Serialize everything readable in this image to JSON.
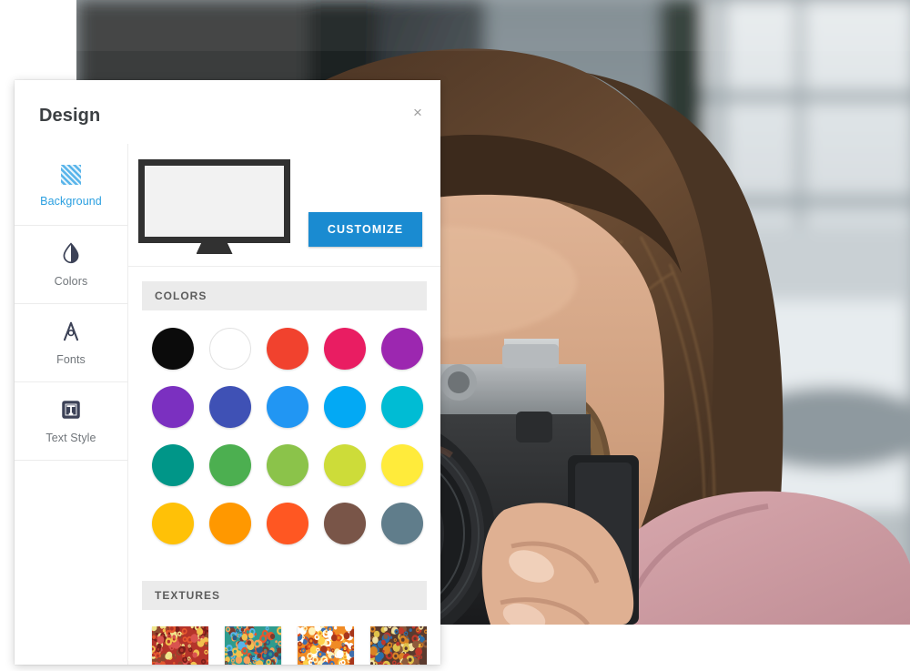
{
  "panel": {
    "title": "Design",
    "close_label": "×"
  },
  "sidebar": {
    "items": [
      {
        "label": "Background",
        "icon": "hatch-pattern-icon",
        "active": true
      },
      {
        "label": "Colors",
        "icon": "droplet-contrast-icon",
        "active": false
      },
      {
        "label": "Fonts",
        "icon": "letter-a-icon",
        "active": false
      },
      {
        "label": "Text Style",
        "icon": "text-style-t-icon",
        "active": false
      }
    ]
  },
  "preview": {
    "monitor_icon": "monitor-icon",
    "customize_label": "CUSTOMIZE",
    "accent_color": "#1a8bd1"
  },
  "colors_section": {
    "header": "COLORS",
    "rows": [
      [
        {
          "name": "black",
          "hex": "#0b0b0b"
        },
        {
          "name": "white",
          "hex": "#ffffff"
        },
        {
          "name": "red",
          "hex": "#f1422e"
        },
        {
          "name": "pink",
          "hex": "#e91d62"
        },
        {
          "name": "purple",
          "hex": "#9c27b0"
        }
      ],
      [
        {
          "name": "deep-purple",
          "hex": "#7b30c0"
        },
        {
          "name": "indigo",
          "hex": "#3f51b5"
        },
        {
          "name": "blue",
          "hex": "#2196f3"
        },
        {
          "name": "light-blue",
          "hex": "#03a9f4"
        },
        {
          "name": "cyan",
          "hex": "#00bcd4"
        }
      ],
      [
        {
          "name": "teal",
          "hex": "#009688"
        },
        {
          "name": "green",
          "hex": "#4caf50"
        },
        {
          "name": "light-green",
          "hex": "#8bc34a"
        },
        {
          "name": "lime",
          "hex": "#cddc39"
        },
        {
          "name": "yellow",
          "hex": "#ffeb3b"
        }
      ],
      [
        {
          "name": "amber",
          "hex": "#ffc107"
        },
        {
          "name": "orange",
          "hex": "#ff9800"
        },
        {
          "name": "deep-orange",
          "hex": "#ff5722"
        },
        {
          "name": "brown",
          "hex": "#795548"
        },
        {
          "name": "blue-grey",
          "hex": "#607d8b"
        }
      ]
    ]
  },
  "textures_section": {
    "header": "TEXTURES",
    "items": [
      {
        "name": "texture-red-confetti",
        "base": "#b5342a",
        "dots": [
          "#f2c14e",
          "#e4572e",
          "#7a1f1a",
          "#d9534f",
          "#f0e68c",
          "#8c4a2f"
        ]
      },
      {
        "name": "texture-teal-rings",
        "base": "#2e9c8e",
        "dots": [
          "#f4a259",
          "#e4572e",
          "#2b5d8a",
          "#f2c14e",
          "#7a3b2e",
          "#58b4ea"
        ]
      },
      {
        "name": "texture-orange-swirls",
        "base": "#f08a24",
        "dots": [
          "#ffd24a",
          "#e04e1b",
          "#3f6fae",
          "#fff1b8",
          "#a8361a",
          "#ffffff"
        ]
      },
      {
        "name": "texture-brown-speckle",
        "base": "#5a3a2e",
        "dots": [
          "#e0c24a",
          "#c0392b",
          "#2b6ea8",
          "#d98324",
          "#8e5a3b",
          "#f0e0a0"
        ]
      }
    ]
  },
  "background_photo": {
    "name": "photographer-with-camera-photo",
    "description": "Woman holding a vintage film camera to her face on a city street"
  }
}
